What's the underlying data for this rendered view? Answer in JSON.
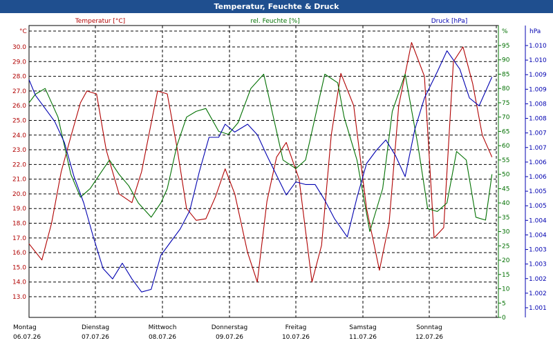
{
  "window": {
    "title": "Temperatur, Feuchte & Druck"
  },
  "colors": {
    "temp": "#b00000",
    "hum": "#007000",
    "press": "#0000b0",
    "titlebar": "#1f4f8f",
    "grid": "#000000"
  },
  "chart_data": {
    "type": "line",
    "title": "Temperatur, Feuchte & Druck",
    "grid": true,
    "series_labels": {
      "temp": "Temperatur [°C]",
      "hum": "rel. Feuchte [%]",
      "press": "Druck [hPa]"
    },
    "axes": {
      "left": {
        "unit": "°C",
        "min": 13.0,
        "max": 30.0,
        "ticks": [
          "30.0",
          "29.0",
          "28.0",
          "27.0",
          "26.0",
          "25.0",
          "24.0",
          "23.0",
          "22.0",
          "21.0",
          "20.0",
          "19.0",
          "18.0",
          "17.0",
          "16.0",
          "15.0",
          "14.0",
          "13.0"
        ]
      },
      "mid": {
        "unit": "%",
        "min": 0,
        "max": 95,
        "ticks": [
          "95",
          "90",
          "85",
          "80",
          "75",
          "70",
          "65",
          "60",
          "55",
          "50",
          "45",
          "40",
          "35",
          "30",
          "25",
          "20",
          "15",
          "10",
          "5",
          "0"
        ]
      },
      "right": {
        "unit": "hPa",
        "min": 1000.5,
        "max": 1010.5,
        "ticks": [
          "1.010",
          "1.010",
          "1.009",
          "1.009",
          "1.008",
          "1.008",
          "1.007",
          "1.007",
          "1.006",
          "1.006",
          "1.005",
          "1.005",
          "1.004",
          "1.004",
          "1.003",
          "1.003",
          "1.002",
          "1.002",
          "1.001"
        ]
      }
    },
    "x_labels": [
      {
        "day": "Montag",
        "date": "06.07.26"
      },
      {
        "day": "Dienstag",
        "date": "07.07.26"
      },
      {
        "day": "Mittwoch",
        "date": "08.07.26"
      },
      {
        "day": "Donnerstag",
        "date": "09.07.26"
      },
      {
        "day": "Freitag",
        "date": "10.07.26"
      },
      {
        "day": "Samstag",
        "date": "11.07.26"
      },
      {
        "day": "Sonntag",
        "date": "12.07.26"
      }
    ],
    "x_unit": "days since Montag 06.07.26 00:00",
    "x_range": [
      0,
      7.3
    ],
    "series": [
      {
        "name": "Temperatur [°C]",
        "axis": "left",
        "color": "#b00000",
        "x": [
          0,
          0.2,
          0.35,
          0.5,
          0.65,
          0.8,
          0.9,
          1.05,
          1.2,
          1.4,
          1.6,
          1.75,
          1.9,
          2.0,
          2.15,
          2.3,
          2.45,
          2.6,
          2.75,
          2.9,
          3.05,
          3.2,
          3.4,
          3.55,
          3.7,
          3.85,
          4.0,
          4.2,
          4.4,
          4.55,
          4.7,
          4.85,
          5.05,
          5.25,
          5.45,
          5.6,
          5.75,
          5.95,
          6.15,
          6.3,
          6.45,
          6.6,
          6.75,
          6.9,
          7.05,
          7.2
        ],
        "values": [
          16.6,
          15.5,
          18.0,
          21.5,
          23.9,
          26.2,
          27.0,
          26.8,
          23.0,
          20.0,
          19.4,
          21.5,
          24.8,
          27.0,
          26.8,
          23.2,
          19.0,
          18.2,
          18.3,
          19.8,
          21.7,
          20.0,
          16.0,
          14.0,
          19.5,
          22.5,
          23.5,
          21.0,
          14.0,
          16.5,
          24.0,
          28.2,
          26.0,
          19.0,
          14.8,
          18.0,
          26.0,
          30.3,
          28.0,
          17.0,
          17.7,
          29.0,
          30.0,
          27.5,
          24.0,
          22.5
        ]
      },
      {
        "name": "rel. Feuchte [%]",
        "axis": "mid",
        "color": "#007000",
        "x": [
          0,
          0.1,
          0.25,
          0.45,
          0.55,
          0.65,
          0.8,
          0.95,
          1.1,
          1.25,
          1.4,
          1.55,
          1.7,
          1.9,
          2.05,
          2.15,
          2.3,
          2.45,
          2.6,
          2.75,
          2.95,
          3.1,
          3.25,
          3.45,
          3.65,
          3.8,
          3.95,
          4.15,
          4.3,
          4.45,
          4.6,
          4.8,
          4.9,
          5.1,
          5.3,
          5.5,
          5.65,
          5.85,
          6.05,
          6.2,
          6.35,
          6.5,
          6.65,
          6.8,
          6.95,
          7.1,
          7.2
        ],
        "values": [
          75,
          78,
          80,
          70,
          60,
          50,
          42,
          45,
          50,
          55,
          50,
          46,
          40,
          35,
          40,
          45,
          60,
          70,
          72,
          73,
          65,
          64,
          68,
          80,
          85,
          70,
          55,
          52,
          55,
          70,
          85,
          82,
          70,
          55,
          30,
          45,
          72,
          85,
          60,
          38,
          37,
          40,
          58,
          55,
          35,
          34,
          50
        ]
      },
      {
        "name": "Druck [hPa]",
        "axis": "right",
        "color": "#0000b0",
        "x": [
          0,
          0.1,
          0.25,
          0.4,
          0.55,
          0.7,
          0.85,
          1.0,
          1.15,
          1.3,
          1.45,
          1.6,
          1.75,
          1.9,
          2.05,
          2.2,
          2.35,
          2.5,
          2.65,
          2.8,
          2.95,
          3.05,
          3.2,
          3.4,
          3.55,
          3.7,
          3.9,
          4.0,
          4.15,
          4.3,
          4.45,
          4.6,
          4.75,
          4.95,
          5.1,
          5.25,
          5.4,
          5.55,
          5.7,
          5.85,
          6.0,
          6.15,
          6.35,
          6.5,
          6.7,
          6.85,
          7.0,
          7.2
        ],
        "values": [
          1009.2,
          1008.6,
          1008.1,
          1007.6,
          1006.8,
          1005.5,
          1004.5,
          1003.2,
          1002.0,
          1001.6,
          1002.2,
          1001.6,
          1001.1,
          1001.2,
          1002.5,
          1003.0,
          1003.5,
          1004.2,
          1005.7,
          1007.0,
          1007.0,
          1007.5,
          1007.2,
          1007.5,
          1007.1,
          1006.3,
          1005.3,
          1004.8,
          1005.3,
          1005.2,
          1005.2,
          1004.6,
          1003.9,
          1003.2,
          1004.7,
          1006.0,
          1006.5,
          1006.9,
          1006.3,
          1005.5,
          1007.3,
          1008.5,
          1009.5,
          1010.3,
          1009.6,
          1008.5,
          1008.2,
          1009.3
        ]
      }
    ]
  }
}
